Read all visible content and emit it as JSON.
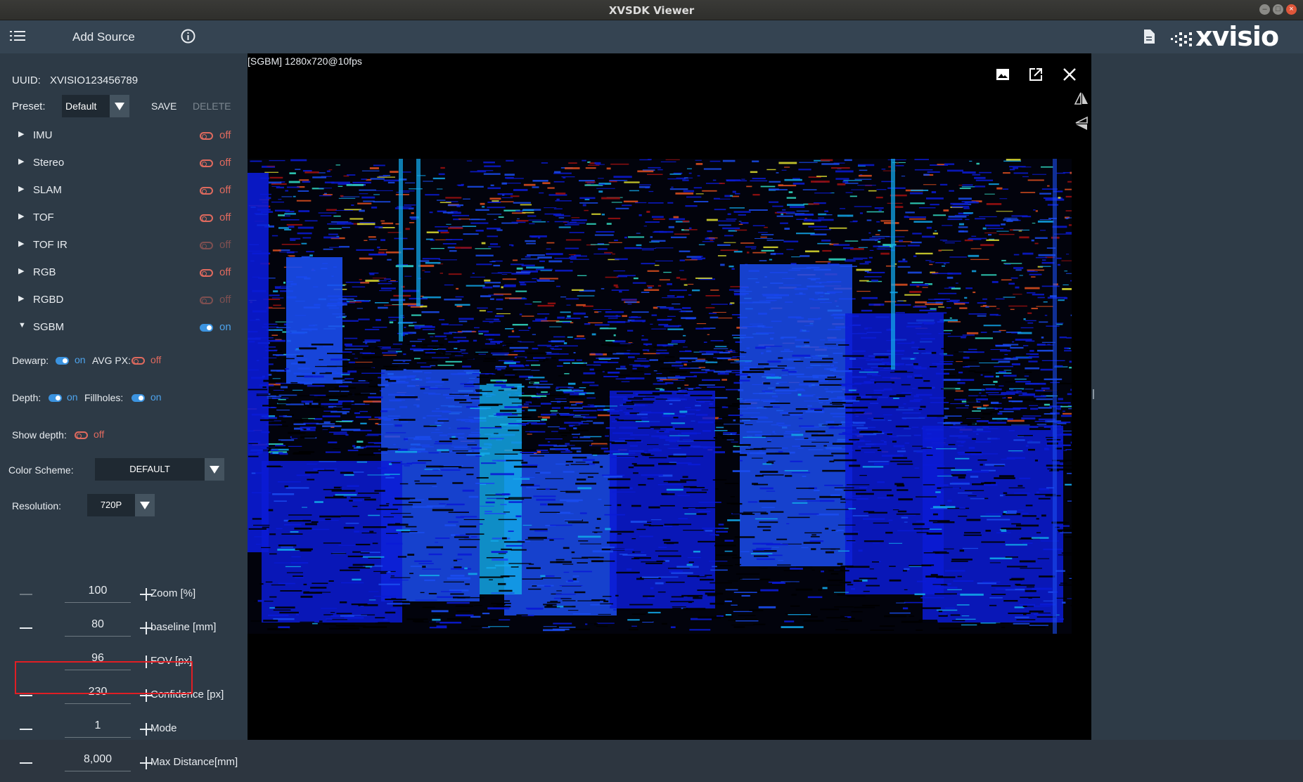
{
  "window": {
    "title": "XVSDK Viewer"
  },
  "toolbar": {
    "add_source_label": "Add Source",
    "logo_text": "xvisio"
  },
  "device": {
    "uuid_label": "UUID:",
    "uuid_value": "XVISIO123456789"
  },
  "preset": {
    "label": "Preset:",
    "value": "Default",
    "save_label": "SAVE",
    "delete_label": "DELETE"
  },
  "modules": [
    {
      "name": "IMU",
      "state": "off",
      "expanded": false,
      "enabled": true
    },
    {
      "name": "Stereo",
      "state": "off",
      "expanded": false,
      "enabled": true
    },
    {
      "name": "SLAM",
      "state": "off",
      "expanded": false,
      "enabled": true
    },
    {
      "name": "TOF",
      "state": "off",
      "expanded": false,
      "enabled": true
    },
    {
      "name": "TOF IR",
      "state": "off",
      "expanded": false,
      "enabled": false
    },
    {
      "name": "RGB",
      "state": "off",
      "expanded": false,
      "enabled": true
    },
    {
      "name": "RGBD",
      "state": "off",
      "expanded": false,
      "enabled": false
    },
    {
      "name": "SGBM",
      "state": "on",
      "expanded": true,
      "enabled": true
    }
  ],
  "sgbm": {
    "dewarp": {
      "label": "Dewarp:",
      "state": "on"
    },
    "avg_px": {
      "label": "AVG PX:",
      "state": "off"
    },
    "depth": {
      "label": "Depth:",
      "state": "on"
    },
    "fillholes": {
      "label": "Fillholes:",
      "state": "on"
    },
    "show_depth": {
      "label": "Show depth:",
      "state": "off"
    },
    "color_scheme": {
      "label": "Color Scheme:",
      "value": "DEFAULT"
    },
    "resolution": {
      "label": "Resolution:",
      "value": "720P"
    },
    "steppers": [
      {
        "value": "100",
        "label": "Zoom [%]"
      },
      {
        "value": "80",
        "label": "baseline [mm]"
      },
      {
        "value": "96",
        "label": "FOV [px]"
      },
      {
        "value": "230",
        "label": "Confidence [px]"
      },
      {
        "value": "1",
        "label": "Mode"
      },
      {
        "value": "8,000",
        "label": "Max Distance[mm]"
      }
    ]
  },
  "view": {
    "stream_label": "[SGBM]  1280x720@10fps",
    "depth_colormap": [
      "#0a1bd6",
      "#1a4cf0",
      "#12a6e8",
      "#32e0c8",
      "#e0e030",
      "#e05020",
      "#a01010"
    ]
  },
  "colors": {
    "accent_on": "#4da3ec",
    "accent_off": "#e06a5e",
    "highlight": "#e01e24"
  }
}
